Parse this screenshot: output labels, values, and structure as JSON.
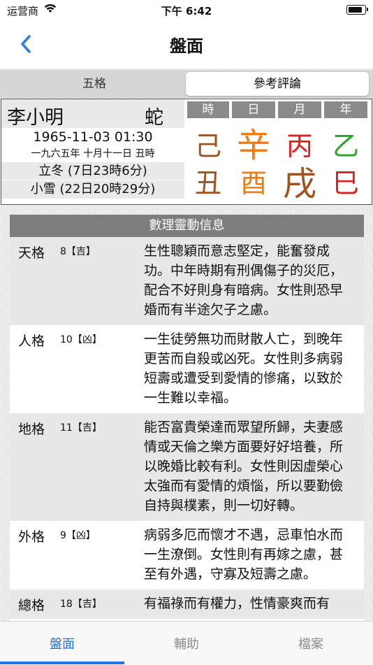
{
  "status_bar": {
    "carrier": "运营商",
    "time": "下午 6:42"
  },
  "nav": {
    "title": "盤面",
    "back_icon": "chevron-left-icon",
    "accent_color": "#2f7de1"
  },
  "segments": [
    {
      "label": "五格",
      "selected": false
    },
    {
      "label": "參考評論",
      "selected": true
    }
  ],
  "person": {
    "name": "李小明",
    "zodiac": "蛇",
    "birth_datetime": "1965-11-03 01:30",
    "lunar_date": "一九六五年 十月十一日 丑時",
    "solar_terms": [
      "立冬 (7日23時6分)",
      "小雪 (22日20時29分)"
    ]
  },
  "pillars": [
    {
      "header": "時",
      "stem": "己",
      "branch": "丑",
      "stem_color": "#a0521d",
      "branch_color": "#a0521d"
    },
    {
      "header": "日",
      "stem": "辛",
      "branch": "酉",
      "stem_color": "#f07b12",
      "branch_color": "#f07b12"
    },
    {
      "header": "月",
      "stem": "丙",
      "branch": "戌",
      "stem_color": "#e02020",
      "branch_color": "#a0521d"
    },
    {
      "header": "年",
      "stem": "乙",
      "branch": "巳",
      "stem_color": "#26a526",
      "branch_color": "#e02020"
    }
  ],
  "numerology": {
    "title": "數理靈動信息",
    "rows": [
      {
        "name": "天格",
        "number": "8【吉】",
        "desc": "生性聰穎而意志堅定，能奮發成功。中年時期有刑偶傷子的災厄，配合不好則身有暗病。女性則恐早婚而有半途欠子之慮。"
      },
      {
        "name": "人格",
        "number": "10【凶】",
        "desc": "一生徒勞無功而財散人亡，到晚年更苦而自殺或凶死。女性則多病弱短壽或遭受到愛情的慘痛，以致於一生難以幸福。"
      },
      {
        "name": "地格",
        "number": "11【吉】",
        "desc": "能否富貴榮達而眾望所歸，夫妻感情或天倫之樂方面要好好培養，所以晚婚比較有利。女性則因虛榮心太強而有愛情的煩惱，所以要勤儉自持與樸素，則一切好轉。"
      },
      {
        "name": "外格",
        "number": "9【凶】",
        "desc": "病弱多厄而懷才不遇，忌車怕水而一生潦倒。女性則有再嫁之慮，甚至有外遇，守寡及短壽之慮。"
      },
      {
        "name": "總格",
        "number": "18【吉】",
        "desc": "有福祿而有權力，性情豪爽而有"
      }
    ]
  },
  "tabs": [
    {
      "label": "盤面",
      "active": true
    },
    {
      "label": "輔助",
      "active": false
    },
    {
      "label": "檔案",
      "active": false
    }
  ]
}
